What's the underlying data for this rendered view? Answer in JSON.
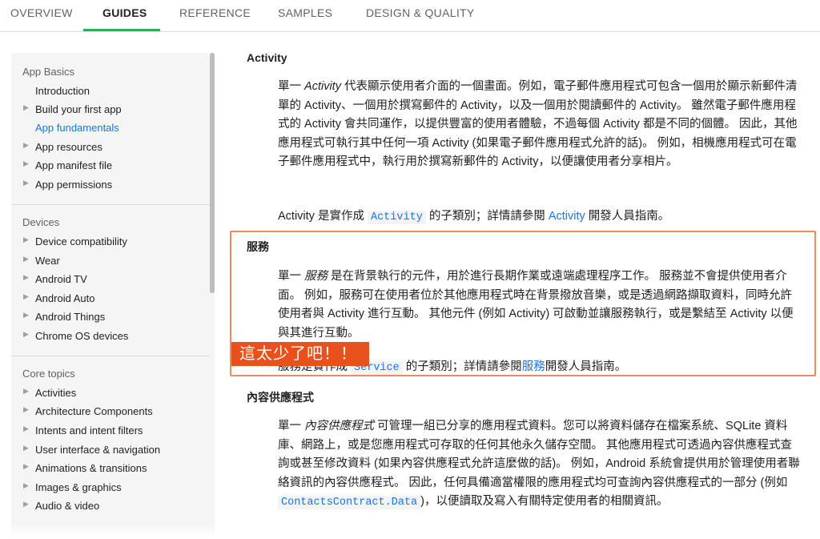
{
  "topnav": {
    "tabs": [
      "OVERVIEW",
      "GUIDES",
      "REFERENCE",
      "SAMPLES",
      "DESIGN & QUALITY"
    ],
    "active_tab": "GUIDES",
    "accent_color": "#34a853"
  },
  "sidebar": {
    "sections": [
      {
        "title": "App Basics",
        "items": [
          {
            "label": "Introduction",
            "expandable": false
          },
          {
            "label": "Build your first app",
            "expandable": true
          },
          {
            "label": "App fundamentals",
            "expandable": false,
            "selected": true
          },
          {
            "label": "App resources",
            "expandable": true
          },
          {
            "label": "App manifest file",
            "expandable": true
          },
          {
            "label": "App permissions",
            "expandable": true
          }
        ]
      },
      {
        "title": "Devices",
        "items": [
          {
            "label": "Device compatibility",
            "expandable": true
          },
          {
            "label": "Wear",
            "expandable": true
          },
          {
            "label": "Android TV",
            "expandable": true
          },
          {
            "label": "Android Auto",
            "expandable": true
          },
          {
            "label": "Android Things",
            "expandable": true
          },
          {
            "label": "Chrome OS devices",
            "expandable": true
          }
        ]
      },
      {
        "title": "Core topics",
        "items": [
          {
            "label": "Activities",
            "expandable": true
          },
          {
            "label": "Architecture Components",
            "expandable": true
          },
          {
            "label": "Intents and intent filters",
            "expandable": true
          },
          {
            "label": "User interface & navigation",
            "expandable": true
          },
          {
            "label": "Animations & transitions",
            "expandable": true
          },
          {
            "label": "Images & graphics",
            "expandable": true
          },
          {
            "label": "Audio & video",
            "expandable": true
          }
        ]
      }
    ]
  },
  "content": {
    "activity": {
      "heading": "Activity",
      "p1_intro": "單一 ",
      "p1_term": "Activity",
      "p1_rest": " 代表顯示使用者介面的一個畫面。例如，電子郵件應用程式可包含一個用於顯示新郵件清單的 Activity、一個用於撰寫郵件的 Activity，以及一個用於閱讀郵件的 Activity。 雖然電子郵件應用程式的 Activity 會共同運作，以提供豐富的使用者體驗，不過每個 Activity 都是不同的個體。 因此，其他應用程式可執行其中任何一項 Activity (如果電子郵件應用程式允許的話)。 例如，相機應用程式可在電子郵件應用程式中，執行用於撰寫新郵件的 Activity，以便讓使用者分享相片。",
      "p2_pre": "Activity 是實作成 ",
      "p2_code": "Activity",
      "p2_mid": " 的子類別；詳情請參閱 ",
      "p2_link": "Activity",
      "p2_post": " 開發人員指南。"
    },
    "service": {
      "heading": "服務",
      "p1_intro": "單一 ",
      "p1_term": "服務",
      "p1_rest": " 是在背景執行的元件，用於進行長期作業或遠端處理程序工作。 服務並不會提供使用者介面。 例如，服務可在使用者位於其他應用程式時在背景撥放音樂，或是透過網路擷取資料，同時允許使用者與 Activity 進行互動。 其他元件 (例如 Activity) 可啟動並讓服務執行，或是繫結至 Activity 以便與其進行互動。",
      "p2_pre": "服務是實作成 ",
      "p2_code": "Service",
      "p2_mid": " 的子類別；詳情請參閱",
      "p2_link": "服務",
      "p2_post": "開發人員指南。"
    },
    "provider": {
      "heading": "內容供應程式",
      "p1_intro": "單一 ",
      "p1_term": "內容供應程式",
      "p1_rest_a": " 可管理一組已分享的應用程式資料。您可以將資料儲存在檔案系統、SQLite 資料庫、網路上，或是您應用程式可存取的任何其他永久儲存空間。 其他應用程式可透過內容供應程式查詢或甚至修改資料 (如果內容供應程式允許這麼做的話)。 例如，Android 系統會提供用於管理使用者聯絡資訊的內容供應程式。 因此，任何具備適當權限的應用程式均可查詢內容供應程式的一部分 (例如 ",
      "p1_code": "ContactsContract.Data",
      "p1_rest_b": ")，以便讀取及寫入有關特定使用者的相關資訊。"
    }
  },
  "annotation": {
    "callout_text": "這太少了吧！！",
    "box_color": "#f08a5d",
    "callout_color": "#e8501c"
  }
}
